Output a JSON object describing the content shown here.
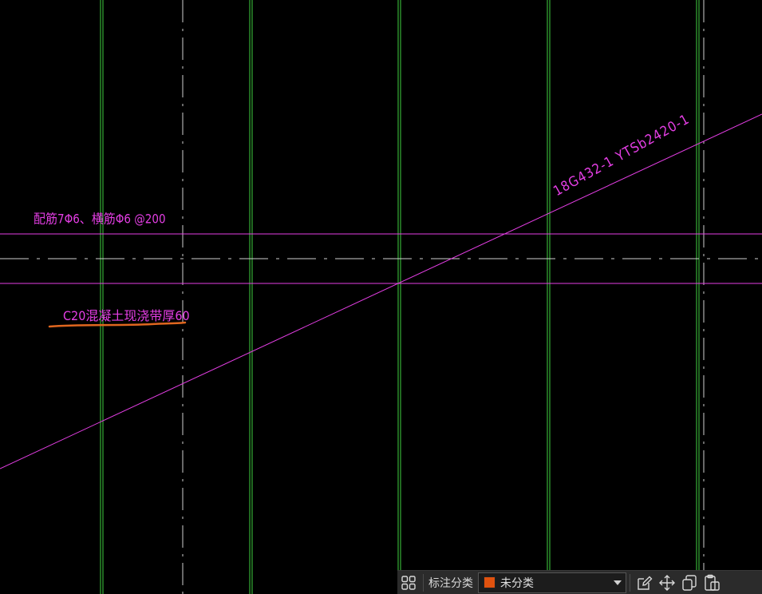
{
  "drawing": {
    "note_rebar": "配筋7Φ6、横筋Φ6 @200",
    "note_concrete": "C20混凝土现浇带厚60",
    "note_reference": "18G432-1   YTSb2420-1",
    "colors": {
      "background": "#000000",
      "column_lines": "#3fd23f",
      "annotation": "#e43ee4",
      "axis_dash": "#d8d8d8",
      "highlight_underline": "#e0661f"
    }
  },
  "toolbar": {
    "category_label": "标注分类",
    "category_value": "未分类",
    "category_color": "#e0520f",
    "icons": [
      "grid-icon",
      "edit-icon",
      "move-icon",
      "copy-icon",
      "paste-icon"
    ]
  }
}
